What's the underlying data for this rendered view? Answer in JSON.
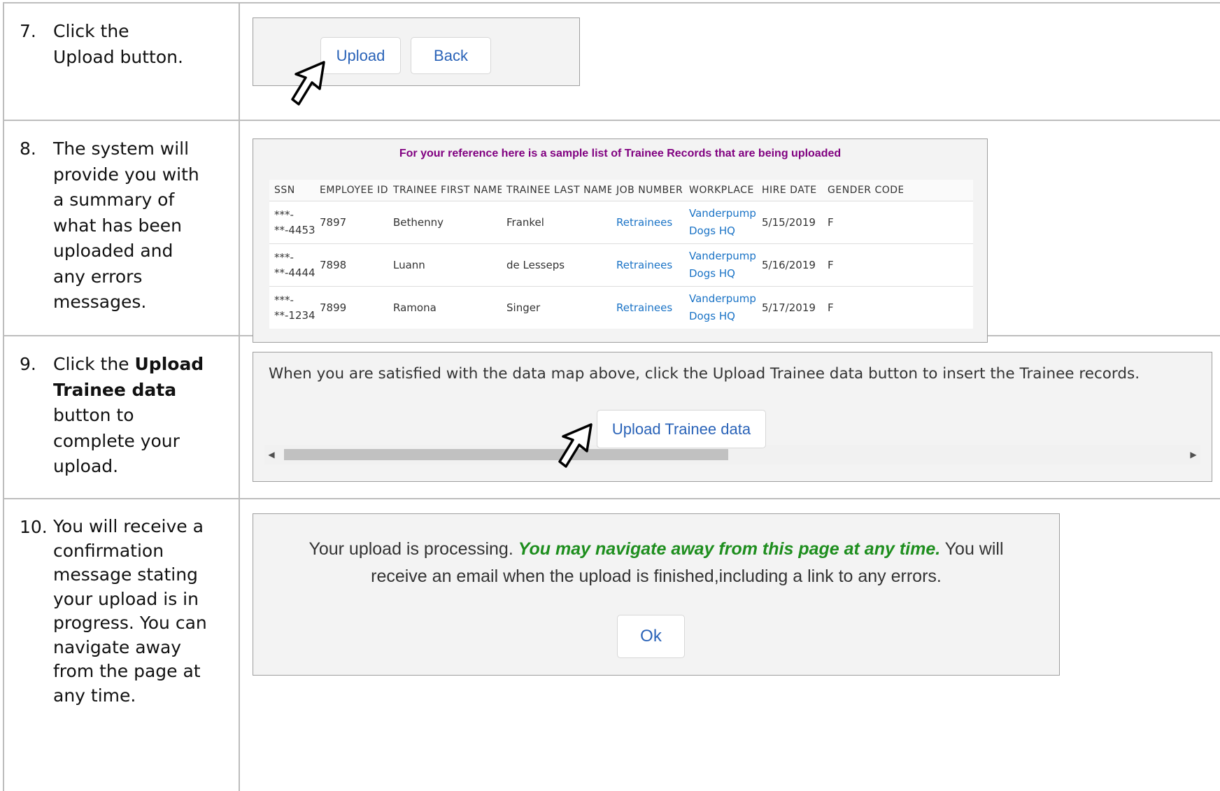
{
  "steps": [
    {
      "number": "7.",
      "text_lines": [
        "Click the Upload button."
      ]
    },
    {
      "number": "8.",
      "text": "The system will provide you with a summary of what has been uploaded and any errors messages."
    },
    {
      "number": "9.",
      "text_before": "Click the ",
      "text_bold": "Upload Trainee data",
      "text_after": " button to complete your upload."
    },
    {
      "number": "10.",
      "text": "You will receive a confirmation message stating your upload is in progress. You can navigate away from the page at any time."
    }
  ],
  "step7_panel": {
    "upload_label": "Upload",
    "back_label": "Back"
  },
  "step8_panel": {
    "reference_text": "For your reference here is a sample list of Trainee Records that are being uploaded",
    "columns": [
      "SSN",
      "EMPLOYEE ID",
      "TRAINEE FIRST NAME",
      "TRAINEE LAST NAME",
      "JOB NUMBER",
      "WORKPLACE",
      "HIRE DATE",
      "GENDER CODE"
    ],
    "rows": [
      {
        "ssn_top": "***-",
        "ssn_bottom": "**-4453",
        "employee_id": "7897",
        "first": "Bethenny",
        "last": "Frankel",
        "job": "Retrainees",
        "wp_top": "Vanderpump",
        "wp_bottom": "Dogs HQ",
        "hire": "5/15/2019",
        "gender": "F"
      },
      {
        "ssn_top": "***-",
        "ssn_bottom": "**-4444",
        "employee_id": "7898",
        "first": "Luann",
        "last": "de Lesseps",
        "job": "Retrainees",
        "wp_top": "Vanderpump",
        "wp_bottom": "Dogs HQ",
        "hire": "5/16/2019",
        "gender": "F"
      },
      {
        "ssn_top": "***-",
        "ssn_bottom": "**-1234",
        "employee_id": "7899",
        "first": "Ramona",
        "last": "Singer",
        "job": "Retrainees",
        "wp_top": "Vanderpump",
        "wp_bottom": "Dogs HQ",
        "hire": "5/17/2019",
        "gender": "F"
      }
    ]
  },
  "step9_panel": {
    "message": "When you are satisfied with the data map above, click the Upload Trainee data button to insert the Trainee records.",
    "upload_trainee_label": "Upload Trainee data",
    "scroll_left_glyph": "◀",
    "scroll_right_glyph": "▶"
  },
  "step10_panel": {
    "line1_before": "Your upload is processing. ",
    "line1_emphasis": "You may navigate away from this page at any time.",
    "line1_after": " You will",
    "line2": "receive an email when the upload is finished,including a link to any errors.",
    "ok_label": "Ok"
  },
  "colors": {
    "button_text": "#2a63b8",
    "reference_text": "#800080",
    "link": "#1a73c6",
    "emphasis": "#1e8e1e"
  },
  "icons": {
    "pointer": "hand-pointer-icon"
  }
}
